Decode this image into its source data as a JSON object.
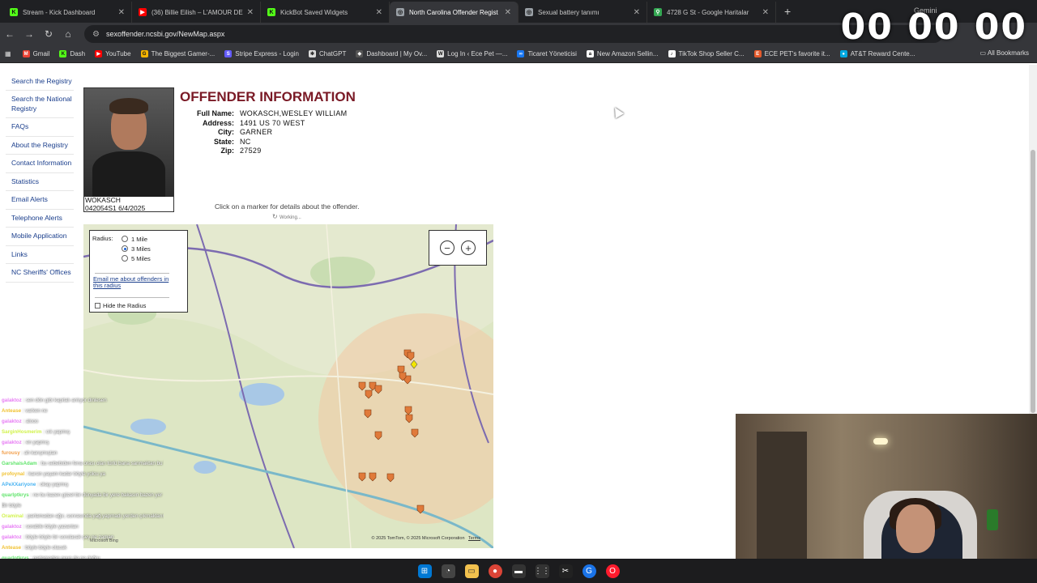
{
  "browser": {
    "tabs": [
      {
        "title": "Stream - Kick Dashboard",
        "icon": "kick-icon",
        "color": "#53fc18",
        "active": false
      },
      {
        "title": "(36) Billie Eilish – L'AMOUR DE",
        "icon": "youtube-icon",
        "color": "#ff0000",
        "active": false
      },
      {
        "title": "KickBot Saved Widgets",
        "icon": "kick-icon",
        "color": "#53fc18",
        "active": false
      },
      {
        "title": "North Carolina Offender Regist",
        "icon": "globe-icon",
        "color": "#9aa0a6",
        "active": true
      },
      {
        "title": "Sexual battery tanımı",
        "icon": "globe-icon",
        "color": "#9aa0a6",
        "active": false
      },
      {
        "title": "4728 G St - Google Haritalar",
        "icon": "maps-icon",
        "color": "#34a853",
        "active": false
      }
    ],
    "new_tab": "+",
    "gemini_label": "Gemini",
    "url": "sexoffender.ncsbi.gov/NewMap.aspx",
    "bookmarks": [
      {
        "label": "Gmail",
        "color": "#ea4335"
      },
      {
        "label": "Dash",
        "color": "#53fc18"
      },
      {
        "label": "YouTube",
        "color": "#ff0000"
      },
      {
        "label": "The Biggest Gamer-...",
        "color": "#f5b400"
      },
      {
        "label": "Stripe Express - Login",
        "color": "#635bff"
      },
      {
        "label": "ChatGPT",
        "color": "#dddddd"
      },
      {
        "label": "Dashboard | My Ov...",
        "color": "#444444"
      },
      {
        "label": "Log In ‹ Ece Pet —...",
        "color": "#dddddd"
      },
      {
        "label": "Ticaret Yöneticisi",
        "color": "#1877f2"
      },
      {
        "label": "New Amazon Sellin...",
        "color": "#ffffff"
      },
      {
        "label": "TikTok Shop Seller C...",
        "color": "#ffffff"
      },
      {
        "label": "ECE PET's favorite it...",
        "color": "#e55a2b"
      },
      {
        "label": "AT&T Reward Cente...",
        "color": "#00a8e0"
      }
    ],
    "all_bookmarks": "All Bookmarks"
  },
  "overlay": {
    "timer": "00 00 00"
  },
  "sidebar": {
    "items": [
      "Search the Registry",
      "Search the National Registry",
      "FAQs",
      "About the Registry",
      "Contact Information",
      "Statistics",
      "Email Alerts",
      "Telephone Alerts",
      "Mobile Application",
      "Links",
      "NC Sheriffs' Offices"
    ]
  },
  "offender": {
    "heading": "OFFENDER INFORMATION",
    "photo_caption_name": "WOKASCH",
    "photo_caption_id": "042054S1 6/4/2025",
    "fields": [
      {
        "label": "Full Name:",
        "value": "WOKASCH,WESLEY WILLIAM"
      },
      {
        "label": "Address:",
        "value": "1491 US 70 WEST"
      },
      {
        "label": "City:",
        "value": "GARNER"
      },
      {
        "label": "State:",
        "value": "NC"
      },
      {
        "label": "Zip:",
        "value": "27529"
      }
    ]
  },
  "map": {
    "hint": "Click on a marker for details about the offender.",
    "working": "Working...",
    "radius_label": "Radius:",
    "radius_options": [
      "1 Mile",
      "3 Miles",
      "5 Miles"
    ],
    "radius_selected": "3 Miles",
    "email_link": "Email me about offenders in this radius",
    "hide_radius": "Hide the Radius",
    "zoom_out": "−",
    "zoom_in": "+",
    "copyright": "© 2025 TomTom, © 2025 Microsoft Corporation",
    "terms": "Terms",
    "brand": "Microsoft Bing"
  },
  "chat": [
    {
      "user": "galaktoz",
      "color": "#e77cf4",
      "msg": "sen dön gibi kapitalı anlıyor dinlesen"
    },
    {
      "user": "Antease",
      "color": "#f1c232",
      "msg": "varken ne"
    },
    {
      "user": "galaktoz",
      "color": "#e77cf4",
      "msg": "alooo"
    },
    {
      "user": "SarginHosmerim",
      "color": "#d1f24b",
      "msg": "cık yapmış"
    },
    {
      "user": "galaktoz",
      "color": "#e77cf4",
      "msg": "en yapmış"
    },
    {
      "user": "furousy",
      "color": "#f29f4b",
      "msg": "ah karışmıştan"
    },
    {
      "user": "GarshaisAdam",
      "color": "#60e46b",
      "msg": "bu sebebiden fena orası olan türlü bana sanmaktan bu Tanklı olarak"
    },
    {
      "user": "profoynal",
      "color": "#f1c232",
      "msg": "karsin yaşam kadar böyle yolcu ya"
    },
    {
      "user": "APeXXariyone",
      "color": "#4bb4f2",
      "msg": "okay yapmış"
    },
    {
      "user": "quarlptkrys",
      "color": "#60e46b",
      "msg": "ne bu bazen güzel bir dünyada bir yere bakasın bazen yer"
    },
    {
      "user": "",
      "color": "#ffffff",
      "msg": "Bir böyle"
    },
    {
      "user": "Oraminal",
      "color": "#d1f24b",
      "msg": "parlamadan ağır, sonrasında yağ yapmadı yerden çıkmaklarına dallada"
    },
    {
      "user": "galaktoz",
      "color": "#e77cf4",
      "msg": "sorabile böyle yazanları"
    },
    {
      "user": "galaktoz",
      "color": "#e77cf4",
      "msg": "böyle böyle bir sorulacak şey ne zaman"
    },
    {
      "user": "Antease",
      "color": "#f1c232",
      "msg": "böyle böyle olacak"
    },
    {
      "user": "quarlptkrys",
      "color": "#60e46b",
      "msg": "parlamadan oyun da ne doğru"
    },
    {
      "user": "",
      "color": "#f24b4b",
      "msg": "tmm bizde nerde gördün mesela"
    },
    {
      "user": "BapBapx",
      "color": "#4bb4f2",
      "msg": "Modemin ne kiık"
    }
  ]
}
